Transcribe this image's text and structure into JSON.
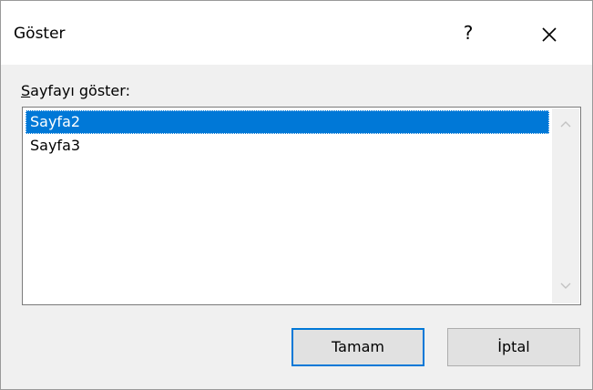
{
  "dialog": {
    "title": "Göster",
    "help_label": "?",
    "close_icon": "close-icon"
  },
  "list": {
    "label_accel": "S",
    "label_rest": "ayfayı göster:",
    "items": [
      {
        "label": "Sayfa2",
        "selected": true
      },
      {
        "label": "Sayfa3",
        "selected": false
      }
    ]
  },
  "buttons": {
    "ok_label": "Tamam",
    "cancel_label": "İptal"
  },
  "colors": {
    "selection": "#0078d7",
    "default_button_border": "#0078d7"
  }
}
